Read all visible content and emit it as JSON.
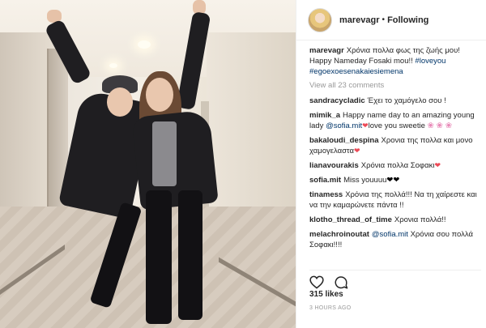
{
  "post": {
    "username": "marevagr",
    "separator": "•",
    "follow_label": "Following",
    "likes": "315 likes",
    "time": "3 HOURS AGO"
  },
  "caption": {
    "username": "marevagr",
    "text_line": "Χρόνια πολλα φως της ζωής μου! Happy Nameday Fosaki mou!!",
    "hashtags": "#loveyou #egoexoesenakaiesiemena"
  },
  "view_all": "View all 23 comments",
  "comments": [
    {
      "user": "sandracycladic",
      "text": "Έχει το χαμόγελο σου !"
    },
    {
      "user": "mimik_a",
      "text_a": "Happy name day to an amazing young lady",
      "mention": "@sofia.mit",
      "heart": "❤",
      "text_b": "love you sweetie",
      "flowers_a": "❀",
      "flowers_b": "❀ ❀"
    },
    {
      "user": "bakaloudi_despina",
      "text": "Χρονια της πολλα και μονο χαμογελαστα",
      "heart": "❤"
    },
    {
      "user": "lianavourakis",
      "text": "Χρόνια πολλα Σοφακι",
      "heart": "❤"
    },
    {
      "user": "sofia.mit",
      "text": "Miss youuuu",
      "hearts": "❤❤"
    },
    {
      "user": "tinamess",
      "text": "Χρόνια της πολλά!!! Να τη χαίρεστε και να την καμαρώνετε πάντα !!"
    },
    {
      "user": "klotho_thread_of_time",
      "text": "Χρονια πολλά!!"
    },
    {
      "user": "melachroinoutat",
      "mention": "@sofia.mit",
      "text": "Χρόνια σου πολλά Σοφακι!!!!"
    }
  ],
  "icons": {
    "like": "heart-outline-icon",
    "comment": "speech-bubble-icon"
  },
  "colors": {
    "link": "#003569",
    "muted": "#999999",
    "text": "#262626",
    "heart": "#ed4956"
  }
}
